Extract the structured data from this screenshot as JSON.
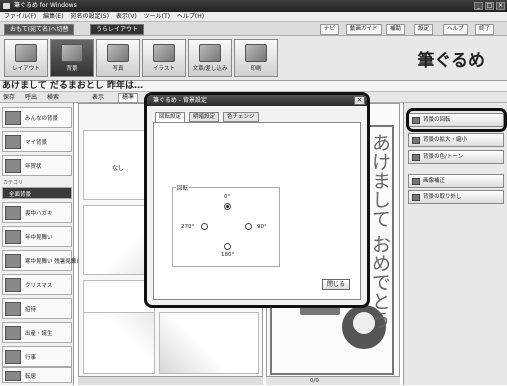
{
  "window": {
    "title": "筆ぐるめ for Windows"
  },
  "menu": [
    "ファイル(F)",
    "編集(E)",
    "宛名の設定(S)",
    "表示(V)",
    "ツール(T)",
    "ヘルプ(H)"
  ],
  "modes": {
    "omote": "おもて(宛て名)へ切替",
    "layout": "うらレイアウト"
  },
  "toolbar_right": [
    "ナビ",
    "動画ガイド",
    "補助",
    "設定",
    "ヘルプ",
    "終了"
  ],
  "ribbon": [
    {
      "label": "レイアウト",
      "icon": "layout-icon"
    },
    {
      "label": "背景",
      "icon": "background-icon"
    },
    {
      "label": "写真",
      "icon": "photo-icon"
    },
    {
      "label": "イラスト",
      "icon": "illustration-icon"
    },
    {
      "label": "文章/差し込み",
      "icon": "text-icon"
    },
    {
      "label": "印刷",
      "icon": "print-icon"
    }
  ],
  "brand": "筆ぐるめ",
  "headline": "あけまして だるまおとし 昨年は…",
  "subbar": {
    "save": "保存",
    "recall": "呼出",
    "search": "検索",
    "display": "表示",
    "standard": "標準"
  },
  "left_items": [
    {
      "label": "みんなの背景"
    },
    {
      "label": "マイ背景"
    },
    {
      "label": "年賀状"
    },
    {
      "label": "全面背景"
    },
    {
      "label": "喪中ハガキ"
    },
    {
      "label": "年中見舞い"
    },
    {
      "label": "寒中見舞い 残暑見舞い"
    },
    {
      "label": "クリスマス"
    },
    {
      "label": "招待"
    },
    {
      "label": "出産・誕生"
    },
    {
      "label": "行事"
    },
    {
      "label": "転居"
    }
  ],
  "left_section": "カテゴリ",
  "grid": {
    "none_label": "なし"
  },
  "card": {
    "greeting": "あけまして おめでとう"
  },
  "pagebar": "0/0",
  "right_buttons": [
    "背景の回転",
    "背景の拡大・縮小",
    "背景の色/トーン",
    "画像補正",
    "背景の取り外し"
  ],
  "dialog": {
    "title": "筆ぐるめ - 背景設定",
    "tabs": [
      "回転設定",
      "明暗設定",
      "色チェンジ"
    ],
    "group_label": "回転",
    "options": {
      "top": "0°",
      "left": "270°",
      "right": "90°",
      "bottom": "180°"
    },
    "selected": "0°",
    "close": "閉じる"
  }
}
